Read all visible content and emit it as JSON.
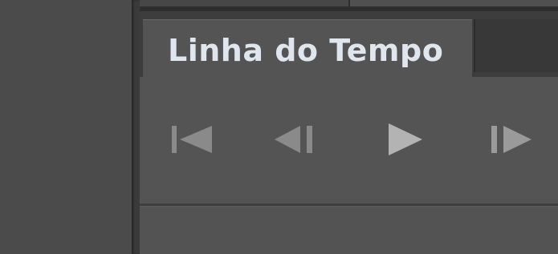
{
  "panel": {
    "tab_title": "Linha do Tempo"
  },
  "controls": {
    "icons": [
      "skip-to-first-frame-icon",
      "step-back-icon",
      "play-icon",
      "step-forward-icon"
    ]
  },
  "colors": {
    "panel_bg": "#545454",
    "tab_bar_bg": "#3d3d3d",
    "tab_text": "#dfe6ee",
    "icon_fill": "#8a8a8a",
    "play_fill": "#b3b3b3"
  }
}
